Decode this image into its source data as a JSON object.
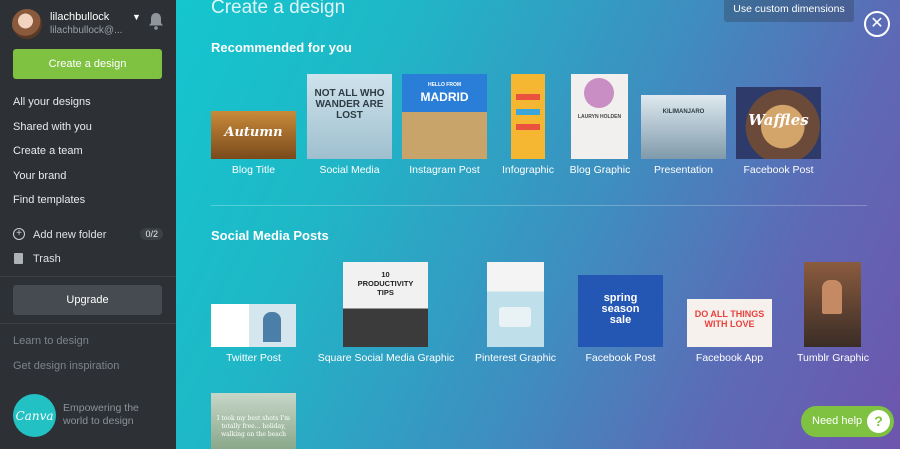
{
  "sidebar": {
    "user": {
      "name": "lilachbullock",
      "email": "lilachbullock@..."
    },
    "create_button": "Create a design",
    "nav": [
      "All your designs",
      "Shared with you",
      "Create a team",
      "Your brand",
      "Find templates"
    ],
    "folder": {
      "label": "Add new folder",
      "count": "0/2"
    },
    "trash": "Trash",
    "upgrade": "Upgrade",
    "learn": "Learn to design",
    "inspiration": "Get design inspiration",
    "logo": "Canva",
    "tagline": "Empowering the world to design"
  },
  "main": {
    "title": "Create a design",
    "custom_dimensions": "Use custom dimensions",
    "recommended_heading": "Recommended for you",
    "social_heading": "Social Media Posts",
    "recommended": [
      {
        "label": "Blog Title",
        "thumb_text": "Autumn"
      },
      {
        "label": "Social Media",
        "thumb_text": "NOT ALL WHO WANDER ARE LOST"
      },
      {
        "label": "Instagram Post",
        "thumb_text": "MADRID",
        "thumb_sub": "HELLO FROM"
      },
      {
        "label": "Infographic",
        "thumb_text": ""
      },
      {
        "label": "Blog Graphic",
        "thumb_text": "LAURYN HOLDEN"
      },
      {
        "label": "Presentation",
        "thumb_text": "KILIMANJARO"
      },
      {
        "label": "Facebook Post",
        "thumb_text": "Waffles"
      }
    ],
    "social": [
      {
        "label": "Twitter Post",
        "thumb_text": ""
      },
      {
        "label": "Square Social Media Graphic",
        "thumb_text": "10 PRODUCTIVITY TIPS"
      },
      {
        "label": "Pinterest Graphic",
        "thumb_text": ""
      },
      {
        "label": "Facebook Post",
        "thumb_text": "spring season sale"
      },
      {
        "label": "Facebook App",
        "thumb_text": "DO ALL THINGS WITH LOVE"
      },
      {
        "label": "Tumblr Graphic",
        "thumb_text": ""
      }
    ],
    "extra_thumb_text": "I took my best shots I'm totally free... holiday, walking on the beach"
  },
  "help": {
    "label": "Need help",
    "icon": "?"
  },
  "colors": {
    "accent": "#7fc241",
    "sidebar": "#2d3135",
    "teal": "#14c6cf",
    "purple": "#6e55ad"
  }
}
